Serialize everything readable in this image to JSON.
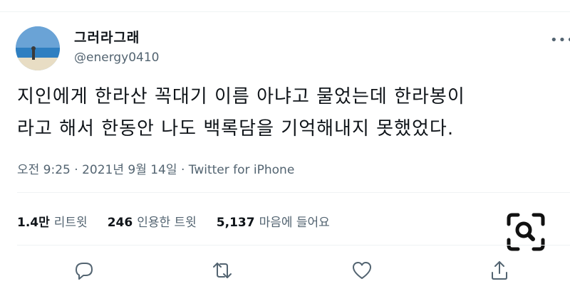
{
  "tweet": {
    "display_name": "그러라그래",
    "handle": "@energy0410",
    "text_lines": [
      "지인에게 한라산 꼭대기 이름 아냐고 물었는데 한라봉이",
      "라고 해서 한동안 나도 백록담을 기억해내지 못했었다."
    ],
    "time": "오전 9:25",
    "date": "2021년 9월 14일",
    "separator": "·",
    "source": "Twitter for iPhone"
  },
  "stats": {
    "retweets": {
      "count": "1.4만",
      "label": "리트윗"
    },
    "quotes": {
      "count": "246",
      "label": "인용한 트윗"
    },
    "likes": {
      "count": "5,137",
      "label": "마음에 들어요"
    }
  },
  "icons": {
    "more": "more-horizontal-icon",
    "reply": "reply-icon",
    "retweet": "retweet-icon",
    "like": "heart-icon",
    "share": "share-icon",
    "zoom": "magnifier-icon"
  },
  "colors": {
    "text": "#0f1419",
    "secondary": "#536471",
    "divider": "#eff3f4"
  }
}
